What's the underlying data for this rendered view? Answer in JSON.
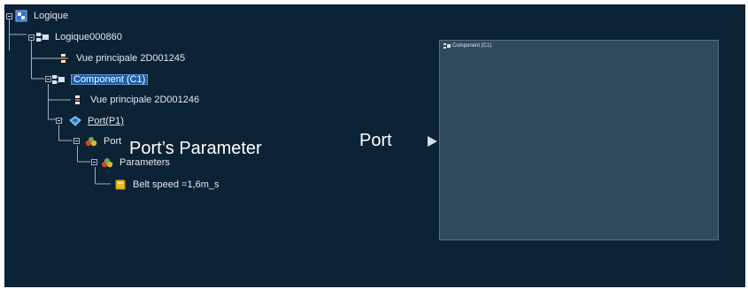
{
  "tree": {
    "root_label": "Logique",
    "logic_label": "Logique000860",
    "view1_label": "Vue principale 2D001245",
    "component_label": "Component (C1)",
    "view2_label": "Vue principale 2D001246",
    "port_node_label": "Port(P1)",
    "port_label": "Port",
    "parameters_label": "Parameters",
    "belt_speed_label": "Belt speed =1,6m_s"
  },
  "annotations": {
    "port_parameter": "Port’s Parameter",
    "port": "Port"
  },
  "component_view": {
    "title": "Component (C1)"
  },
  "colors": {
    "background": "#0c2235",
    "selection": "#1b5ea9",
    "component_frame": "#2f4a5a"
  },
  "icons": {
    "root": "logic-tree-icon",
    "logic": "logic-node-icon",
    "view": "main-view-icon",
    "component": "component-icon",
    "port_node": "port-icon",
    "port": "port-fruit-icon",
    "parameters": "parameters-icon",
    "belt_speed": "parameter-value-icon"
  }
}
